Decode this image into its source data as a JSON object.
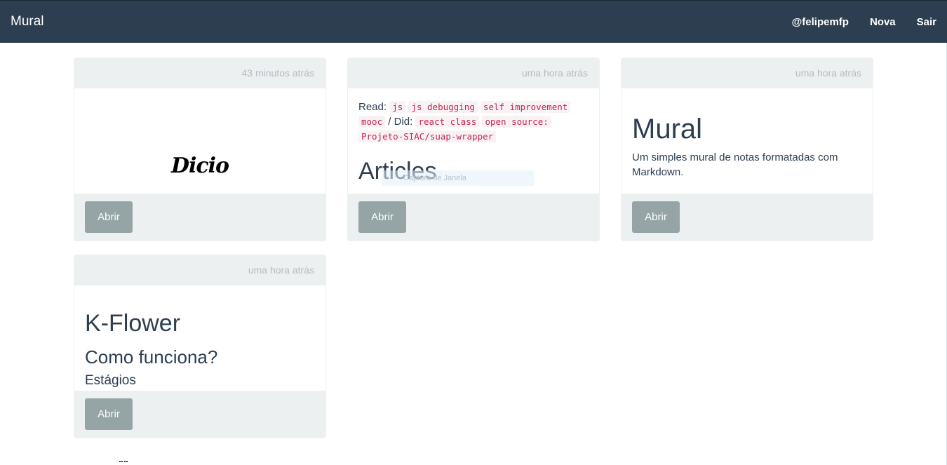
{
  "navbar": {
    "brand": "Mural",
    "links": [
      "@felipemfp",
      "Nova",
      "Sair"
    ]
  },
  "cards": [
    {
      "time": "43 minutos atrás",
      "logo_text": "Dicio",
      "button": "Abrir"
    },
    {
      "time": "uma hora atrás",
      "read_label": "Read:",
      "read_tags": [
        "js",
        "js debugging",
        "self improvement",
        "mooc"
      ],
      "did_label": "/ Did:",
      "did_tags": [
        "react class",
        "open source:",
        "Projeto-SIAC/suap-wrapper"
      ],
      "heading": "Articles",
      "overlay_text": "Captura de Janela",
      "button": "Abrir"
    },
    {
      "time": "uma hora atrás",
      "heading": "Mural",
      "description": "Um simples mural de notas formatadas com Markdown.",
      "button": "Abrir"
    },
    {
      "time": "uma hora atrás",
      "heading": "K-Flower",
      "subheading": "Como funciona?",
      "subsubheading": "Estágios",
      "button": "Abrir"
    }
  ]
}
